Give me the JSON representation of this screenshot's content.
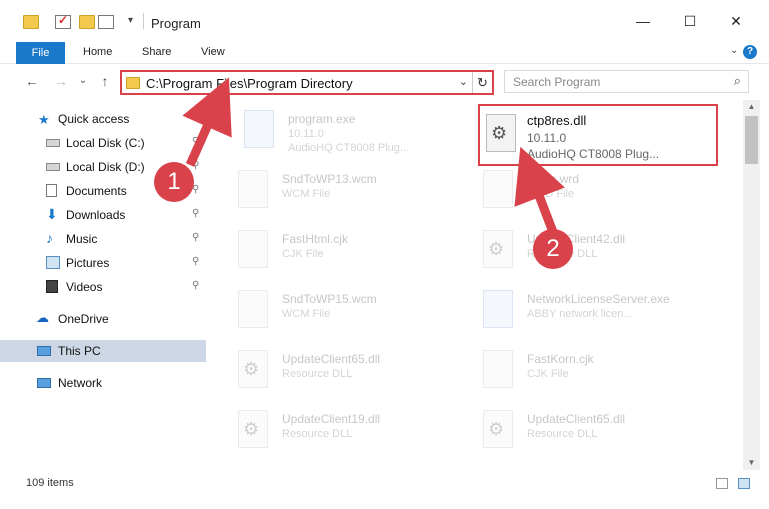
{
  "window": {
    "title": "Program",
    "minimize": "—",
    "maximize": "☐",
    "close": "✕"
  },
  "ribbon": {
    "tabs": [
      "File",
      "Home",
      "Share",
      "View"
    ],
    "help": "?"
  },
  "nav": {
    "back": "←",
    "forward": "→",
    "recent": "⌄",
    "up": "↑",
    "address": "C:\\Program Files\\Program Directory",
    "dropdown": "⌄",
    "refresh": "↻",
    "search_placeholder": "Search Program",
    "search_icon": "search-icon"
  },
  "sidebar": {
    "items": [
      {
        "label": "Quick access",
        "icon": "star-icon",
        "pinned": false
      },
      {
        "label": "Local Disk (C:)",
        "icon": "drive-icon",
        "pinned": true
      },
      {
        "label": "Local Disk (D:)",
        "icon": "drive-icon",
        "pinned": true
      },
      {
        "label": "Documents",
        "icon": "documents-icon",
        "pinned": true
      },
      {
        "label": "Downloads",
        "icon": "download-icon",
        "pinned": true
      },
      {
        "label": "Music",
        "icon": "music-icon",
        "pinned": true
      },
      {
        "label": "Pictures",
        "icon": "pictures-icon",
        "pinned": true
      },
      {
        "label": "Videos",
        "icon": "videos-icon",
        "pinned": true
      },
      {
        "label": "OneDrive",
        "icon": "cloud-icon",
        "pinned": false
      },
      {
        "label": "This PC",
        "icon": "pc-icon",
        "pinned": false,
        "selected": true
      },
      {
        "label": "Network",
        "icon": "network-icon",
        "pinned": false
      }
    ],
    "pin_glyph": "📌"
  },
  "files": [
    {
      "name": "program.exe",
      "line2": "10.11.0",
      "line3": "AudioHQ CT8008 Plug...",
      "icon": "app-icon"
    },
    {
      "name": "ctp8res.dll",
      "line2": "10.11.0",
      "line3": "AudioHQ CT8008 Plug...",
      "icon": "gear-file-icon",
      "highlighted": true
    },
    {
      "name": "SndToWP13.wcm",
      "line2": "WCM File",
      "line3": "",
      "icon": "file-icon"
    },
    {
      "name": "Basic.wrd",
      "line2": "WRD File",
      "line3": "",
      "icon": "file-icon"
    },
    {
      "name": "FastHtml.cjk",
      "line2": "CJK File",
      "line3": "",
      "icon": "file-icon"
    },
    {
      "name": "UpdateClient42.dll",
      "line2": "Resource DLL",
      "line3": "",
      "icon": "gear-file-icon"
    },
    {
      "name": "SndToWP15.wcm",
      "line2": "WCM File",
      "line3": "",
      "icon": "file-icon"
    },
    {
      "name": "NetworkLicenseServer.exe",
      "line2": "ABBY network licen...",
      "line3": "",
      "icon": "app-icon"
    },
    {
      "name": "UpdateClient65.dll",
      "line2": "Resource DLL",
      "line3": "",
      "icon": "gear-file-icon"
    },
    {
      "name": "FastKorn.cjk",
      "line2": "CJK File",
      "line3": "",
      "icon": "file-icon"
    },
    {
      "name": "UpdateClient19.dll",
      "line2": "Resource DLL",
      "line3": "",
      "icon": "gear-file-icon"
    },
    {
      "name": "UpdateClient65.dll",
      "line2": "Resource DLL",
      "line3": "",
      "icon": "gear-file-icon"
    }
  ],
  "status": {
    "count": "109 items"
  },
  "annotations": {
    "badge1": "1",
    "badge2": "2",
    "color": "#d9424b"
  }
}
